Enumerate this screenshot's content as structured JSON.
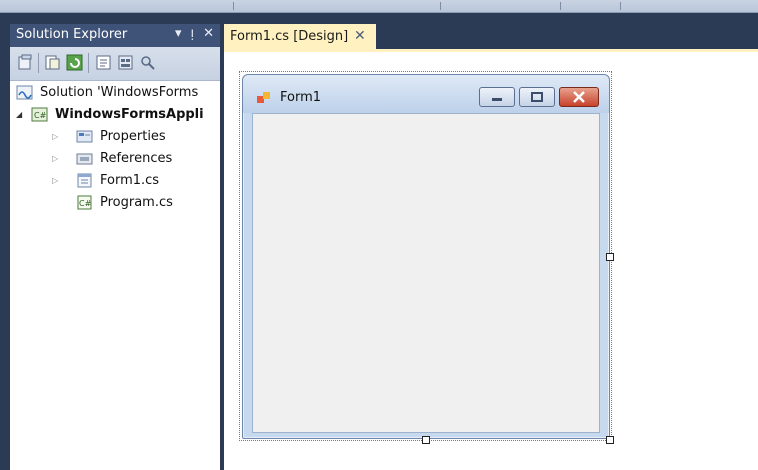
{
  "solution_explorer": {
    "title": "Solution Explorer",
    "controls": {
      "dropdown": "▾",
      "pin": "ᴉ",
      "close": "✕"
    },
    "items": [
      {
        "label": "Solution 'WindowsForms",
        "icon": "solution-icon",
        "expander": ""
      },
      {
        "label": "WindowsFormsAppli",
        "icon": "csharp-project-icon",
        "expander": "◢"
      },
      {
        "label": "Properties",
        "icon": "properties-icon",
        "expander": "▷"
      },
      {
        "label": "References",
        "icon": "references-icon",
        "expander": "▷"
      },
      {
        "label": "Form1.cs",
        "icon": "form-file-icon",
        "expander": "▷"
      },
      {
        "label": "Program.cs",
        "icon": "csharp-file-icon",
        "expander": ""
      }
    ]
  },
  "editor": {
    "tab_label": "Form1.cs [Design]",
    "tab_close": "✕"
  },
  "form": {
    "title": "Form1"
  },
  "colors": {
    "ide_background": "#2b3a55",
    "active_tab": "#fff2c0",
    "panel_header": "#3f5378",
    "form_client": "#f0f0f0"
  }
}
